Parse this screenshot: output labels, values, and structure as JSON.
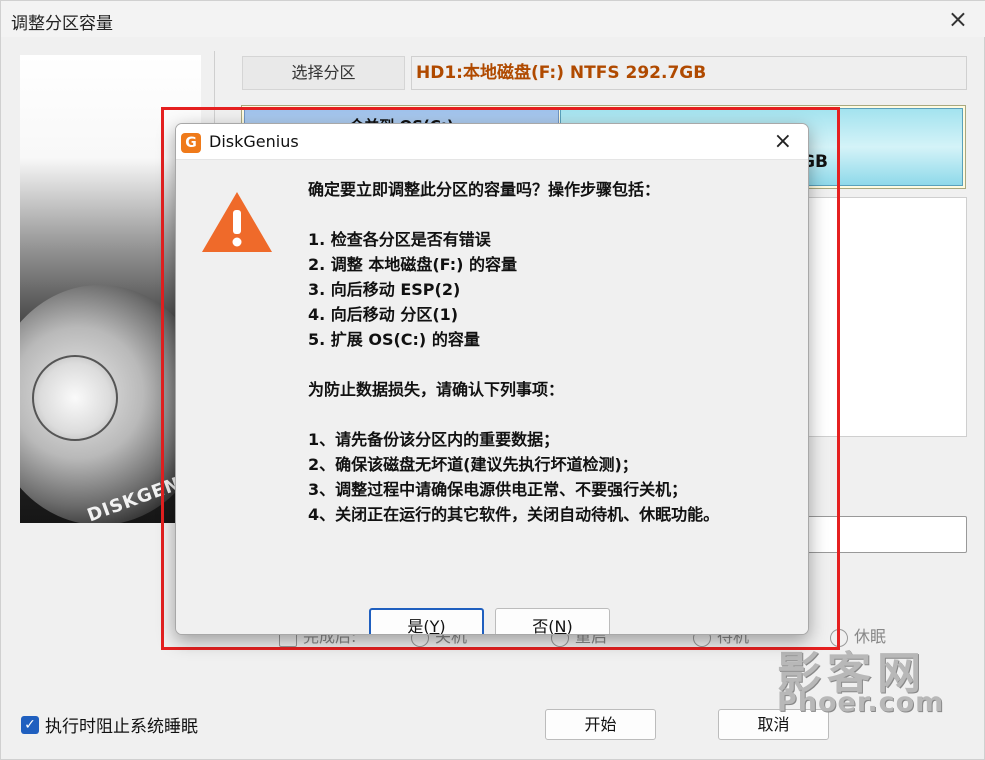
{
  "background_window": {
    "title": "调整分区容量",
    "close_icon": "×",
    "select_button": "选择分区",
    "disk_label": "HD1:本地磁盘(F:) NTFS 292.7GB",
    "partition_left_label": "合并到 OS(C:)",
    "partition_right_label": "GB",
    "image_brand": "DISKGENIUS",
    "after_done_label": "完成后:",
    "radio_options": [
      "关机",
      "重启",
      "待机",
      "休眠"
    ],
    "prevent_sleep_label": "执行时阻止系统睡眠",
    "start_button": "开始",
    "cancel_button": "取消"
  },
  "dialog": {
    "title": "DiskGenius",
    "app_icon_letter": "G",
    "close_icon": "×",
    "question": "确定要立即调整此分区的容量吗？操作步骤包括：",
    "steps": [
      "1. 检查各分区是否有错误",
      "2. 调整 本地磁盘(F:) 的容量",
      "3. 向后移动 ESP(2)",
      "4. 向后移动 分区(1)",
      "5. 扩展 OS(C:) 的容量"
    ],
    "notice_heading": "为防止数据损失，请确认下列事项：",
    "notices": [
      "1、请先备份该分区内的重要数据；",
      "2、确保该磁盘无坏道(建议先执行坏道检测)；",
      "3、调整过程中请确保电源供电正常、不要强行关机；",
      "4、关闭正在运行的其它软件，关闭自动待机、休眠功能。"
    ],
    "yes_button": {
      "text": "是(",
      "key": "Y",
      "end": ")"
    },
    "no_button": {
      "text": "否(",
      "key": "N",
      "end": ")"
    }
  },
  "watermark": {
    "cn": "影客网",
    "en": "Phoer.com"
  },
  "colors": {
    "highlight_box": "#e52020",
    "disk_label_text": "#b04a00",
    "warning_icon": "#ef6a2a",
    "primary_button_border": "#1f5fbf"
  }
}
